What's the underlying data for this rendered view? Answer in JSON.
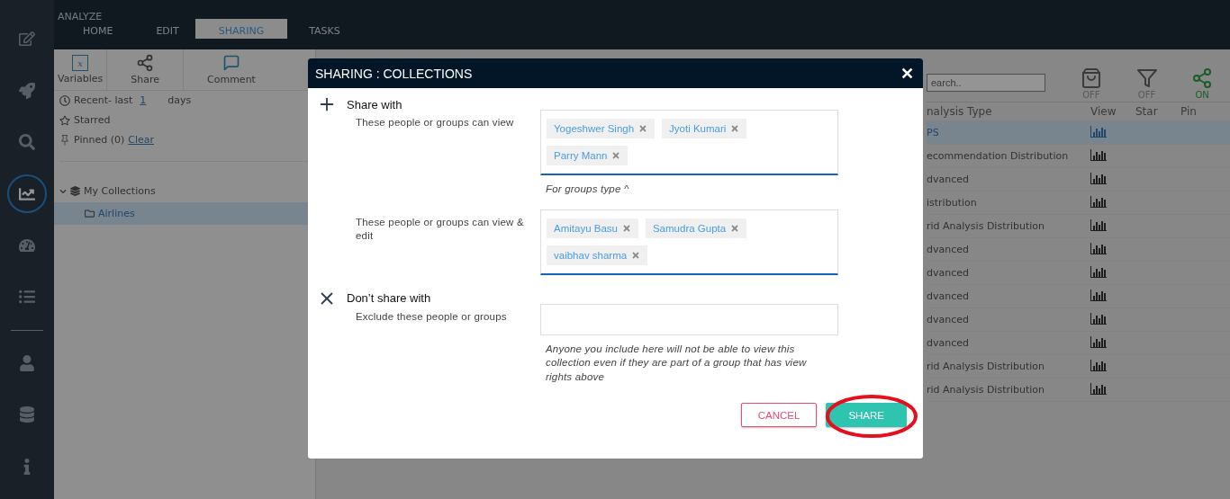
{
  "nav_groups": [
    {
      "items": [
        {
          "kind": "edit",
          "selected": false
        },
        {
          "kind": "rocket",
          "selected": false
        },
        {
          "kind": "search",
          "selected": false
        },
        {
          "kind": "chart",
          "selected": true
        },
        {
          "kind": "gauge",
          "selected": false
        },
        {
          "kind": "list",
          "selected": false
        }
      ]
    },
    {
      "items": [
        {
          "kind": "user",
          "selected": false
        },
        {
          "kind": "database",
          "selected": false
        },
        {
          "kind": "info",
          "selected": false
        }
      ]
    }
  ],
  "section": "ANALYZE",
  "tabs": [
    {
      "label": "HOME",
      "selected": false
    },
    {
      "label": "EDIT",
      "selected": false
    },
    {
      "label": "SHARING",
      "selected": true
    },
    {
      "label": "TASKS",
      "selected": false
    }
  ],
  "toolbar": [
    {
      "kind": "variables",
      "label": "Variables",
      "icon_text": "x"
    },
    {
      "kind": "share",
      "label": "Share"
    },
    {
      "kind": "comment",
      "label": "Comment"
    }
  ],
  "filters": {
    "recent": {
      "prefix": "Recent- last",
      "value": "1",
      "suffix": "days"
    },
    "starred": "Starred",
    "pinned": {
      "label": "Pinned (0)",
      "link": "Clear"
    }
  },
  "tree": [
    {
      "label": "My Collections",
      "expanded": true,
      "children": [
        {
          "label": "Airlines",
          "selected": true
        }
      ]
    }
  ],
  "search": {
    "placeholder": "earch.."
  },
  "toggles": [
    {
      "kind": "bag",
      "label": "OFF",
      "on": false
    },
    {
      "kind": "filter",
      "label": "OFF",
      "on": false
    },
    {
      "kind": "share",
      "label": "ON",
      "on": true
    }
  ],
  "table": {
    "columns": [
      "nalysis Type",
      "View",
      "Star",
      "Pin"
    ],
    "rows": [
      {
        "analysis_type": "PS",
        "selected": true
      },
      {
        "analysis_type": "ecommendation Distribution",
        "selected": false
      },
      {
        "analysis_type": "dvanced",
        "selected": false
      },
      {
        "analysis_type": "istribution",
        "selected": false
      },
      {
        "analysis_type": "rid Analysis Distribution",
        "selected": false
      },
      {
        "analysis_type": "dvanced",
        "selected": false
      },
      {
        "analysis_type": "dvanced",
        "selected": false
      },
      {
        "analysis_type": "dvanced",
        "selected": false
      },
      {
        "analysis_type": "dvanced",
        "selected": false
      },
      {
        "analysis_type": "dvanced",
        "selected": false
      },
      {
        "analysis_type": "rid Analysis Distribution",
        "selected": false
      },
      {
        "analysis_type": "rid Analysis Distribution",
        "selected": false
      }
    ]
  },
  "dialog": {
    "title": "SHARING : COLLECTIONS",
    "close": "✕",
    "sections": [
      {
        "kind": "include",
        "heading": "Share with",
        "fields": [
          {
            "label": "These people or groups can view",
            "focused": true,
            "tokens": [
              "Yogeshwer Singh",
              "Jyoti Kumari",
              "Parry Mann"
            ],
            "hint": "For groups type ^"
          },
          {
            "label": "These people or groups can view & edit",
            "focused": true,
            "tokens": [
              "Amitayu Basu",
              "Samudra Gupta",
              "vaibhav sharma"
            ]
          }
        ]
      },
      {
        "kind": "exclude",
        "heading": "Don’t share with",
        "fields": [
          {
            "label": "Exclude these people or groups",
            "focused": false,
            "hint": "Anyone you include here will not be able to view this collection even if they are part of a group that has view rights above"
          }
        ]
      }
    ],
    "buttons": [
      {
        "label": "CANCEL",
        "kind": "secondary"
      },
      {
        "label": "SHARE",
        "kind": "primary",
        "highlighted": true
      }
    ]
  }
}
